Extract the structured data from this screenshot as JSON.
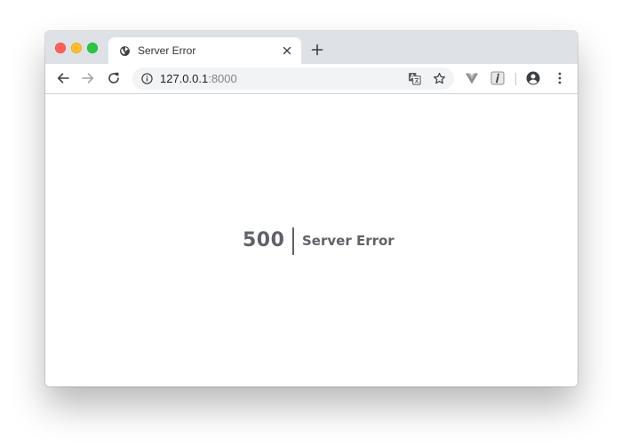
{
  "tab": {
    "title": "Server Error",
    "favicon": "globe-icon"
  },
  "address_bar": {
    "host": "127.0.0.1",
    "port": ":8000"
  },
  "toolbar": {
    "back": "back-arrow-icon",
    "forward": "forward-arrow-icon",
    "reload": "reload-icon",
    "site_info": "info-icon",
    "translate": "translate-icon",
    "bookmark": "star-icon",
    "extension_1": "vuejs-devtools-icon",
    "extension_2": "info-italic-icon",
    "profile": "account-circle-icon",
    "menu": "kebab-menu-icon"
  },
  "page": {
    "code": "500",
    "message": "Server Error"
  },
  "colors": {
    "titlebar": "#dee1e6",
    "error_text": "#5f6368",
    "close_light": "#ff5f57",
    "minimize_light": "#febc2e",
    "maximize_light": "#28c840"
  }
}
